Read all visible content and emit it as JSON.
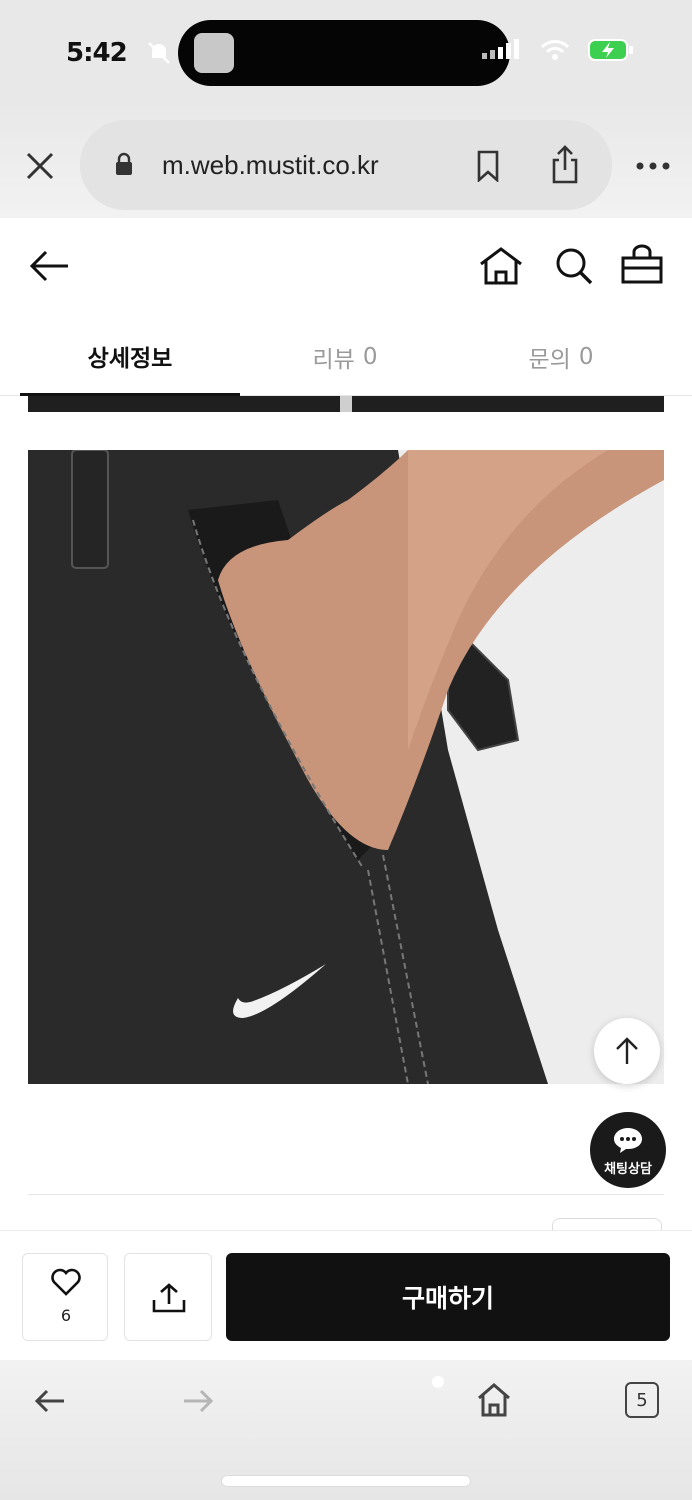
{
  "status_bar": {
    "time": "5:42"
  },
  "browser": {
    "url": "m.web.mustit.co.kr"
  },
  "tabs": [
    {
      "label": "상세정보",
      "count": ""
    },
    {
      "label": "리뷰",
      "count": "0"
    },
    {
      "label": "문의",
      "count": "0"
    }
  ],
  "chat": {
    "label": "채팅상담"
  },
  "action_bar": {
    "like_count": "6",
    "buy_label": "구매하기"
  },
  "toolbar": {
    "tab_count": "5"
  },
  "colors": {
    "primary": "#111111",
    "muted_tab": "#9a9a9a",
    "product_fabric": "#2a2a2a"
  }
}
